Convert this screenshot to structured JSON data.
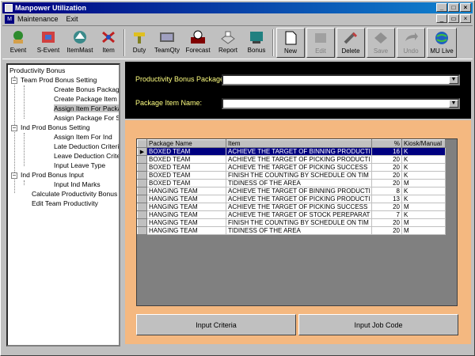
{
  "window": {
    "title": "Manpower Utilization"
  },
  "menu": {
    "items": [
      "Maintenance",
      "Exit"
    ]
  },
  "toolbar": {
    "buttons": [
      {
        "label": "Event",
        "icon": "event-icon"
      },
      {
        "label": "S-Event",
        "icon": "s-event-icon"
      },
      {
        "label": "ItemMast",
        "icon": "item-master-icon"
      },
      {
        "label": "Item",
        "icon": "item-icon"
      },
      {
        "label": "Duty",
        "icon": "duty-icon"
      },
      {
        "label": "TeamQty",
        "icon": "team-qty-icon"
      },
      {
        "label": "Forecast",
        "icon": "forecast-icon"
      },
      {
        "label": "Report",
        "icon": "report-icon"
      },
      {
        "label": "Bonus",
        "icon": "bonus-icon"
      },
      {
        "label": "New",
        "icon": "new-icon"
      },
      {
        "label": "Edit",
        "icon": "edit-icon"
      },
      {
        "label": "Delete",
        "icon": "delete-icon"
      },
      {
        "label": "Save",
        "icon": "save-icon"
      },
      {
        "label": "Undo",
        "icon": "undo-icon"
      },
      {
        "label": "MU Live",
        "icon": "mu-live-icon"
      }
    ]
  },
  "tree": {
    "root": "Productivity Bonus",
    "team_setting": "Team Prod Bonus Setting",
    "create_bonus_package": "Create Bonus Packag",
    "create_package_item": "Create Package Item",
    "assign_item_for_package": "Assign Item For Packa",
    "assign_package_for": "Assign Package For S",
    "ind_setting": "Ind Prod Bonus Setting",
    "assign_item_for_ind": "Assign Item For Ind",
    "late_deduction": "Late Deduction Criteri",
    "leave_deduction": "Leave Deduction Crite",
    "input_leave_type": "Input Leave Type",
    "ind_input": "Ind Prod Bonus Input",
    "input_ind_marks": "Input Ind Marks",
    "calculate": "Calculate Productivity Bonus",
    "edit_team": "Edit Team Productivity"
  },
  "form": {
    "package_label": "Productivity Bonus Package:",
    "package_value": "",
    "item_label": "Package Item Name:",
    "item_value": ""
  },
  "grid": {
    "columns": [
      "Package Name",
      "Item",
      "%",
      "Kiosk/Manual"
    ],
    "rows": [
      [
        "BOXED TEAM",
        "ACHIEVE THE TARGET OF BINNING PRODUCTI",
        "16",
        "K"
      ],
      [
        "BOXED TEAM",
        "ACHIEVE THE TARGET OF PICKING PRODUCTI",
        "20",
        "K"
      ],
      [
        "BOXED TEAM",
        "ACHIEVE THE TARGET OF PICKING SUCCESS",
        "20",
        "K"
      ],
      [
        "BOXED TEAM",
        "FINISH THE COUNTING BY SCHEDULE ON TIM",
        "20",
        "K"
      ],
      [
        "BOXED TEAM",
        "TIDINESS OF THE AREA",
        "20",
        "M"
      ],
      [
        "HANGING TEAM",
        "ACHIEVE THE TARGET OF BINNING PRODUCTI",
        "8",
        "K"
      ],
      [
        "HANGING TEAM",
        "ACHIEVE THE TARGET OF PICKING PRODUCTI",
        "13",
        "K"
      ],
      [
        "HANGING TEAM",
        "ACHIEVE THE TARGET OF PICKING SUCCESS",
        "20",
        "M"
      ],
      [
        "HANGING TEAM",
        "ACHIEVE THE TARGET OF STOCK PEREPARAT",
        "7",
        "K"
      ],
      [
        "HANGING TEAM",
        "FINISH THE COUNTING BY SCHEDULE ON TIM",
        "20",
        "M"
      ],
      [
        "HANGING TEAM",
        "TIDINESS OF THE AREA",
        "20",
        "M"
      ]
    ]
  },
  "buttons": {
    "input_criteria": "Input Criteria",
    "input_job_code": "Input Job Code"
  }
}
